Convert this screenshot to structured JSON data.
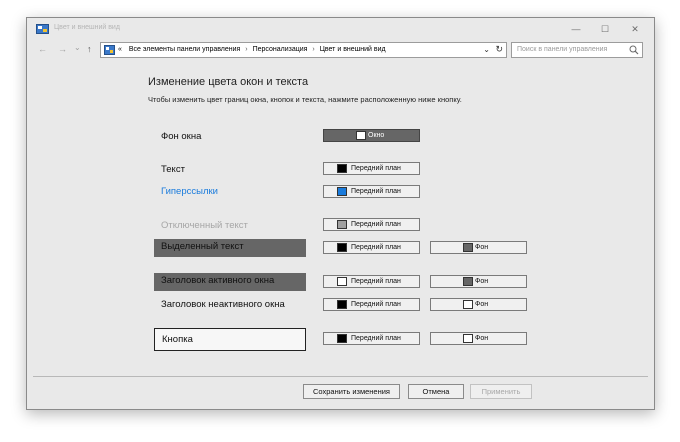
{
  "window": {
    "title": "Цвет и внешний вид",
    "minimize_glyph": "—",
    "maximize_glyph": "☐",
    "close_glyph": "✕"
  },
  "nav": {
    "back_glyph": "←",
    "forward_glyph": "→",
    "recent_glyph": "⌄",
    "up_glyph": "↑"
  },
  "address": {
    "prefix": "«",
    "crumbs": [
      "Все элементы панели управления",
      "Персонализация",
      "Цвет и внешний вид"
    ],
    "separator": "›",
    "chevron": "⌄",
    "refresh": "↻"
  },
  "search": {
    "placeholder": "Поиск в панели управления"
  },
  "content": {
    "heading": "Изменение цвета окон и текста",
    "subtitle": "Чтобы изменить цвет границ окна, кнопок и текста, нажмите расположенную ниже кнопку."
  },
  "rows": {
    "window_bg": {
      "label": "Фон окна",
      "btn": "Окно",
      "swatch": "#ffffff"
    },
    "text": {
      "label": "Текст",
      "btn": "Передний план",
      "swatch": "#000000"
    },
    "hyperlinks": {
      "label": "Гиперссылки",
      "btn": "Передний план",
      "swatch": "#1a7bdc",
      "label_color": "#1a7bdc"
    },
    "disabled_text": {
      "label": "Отключенный текст",
      "btn": "Передний план",
      "swatch": "#a0a0a0",
      "label_color": "#a6a6a6"
    },
    "selected_text": {
      "label": "Выделенный текст",
      "fg_btn": "Передний план",
      "fg_swatch": "#000000",
      "bg_btn": "Фон",
      "bg_swatch": "#666666",
      "box_color": "#666666"
    },
    "active_title": {
      "label": "Заголовок активного окна",
      "fg_btn": "Передний план",
      "fg_swatch": "#ffffff",
      "bg_btn": "Фон",
      "bg_swatch": "#666666",
      "box_color": "#666666"
    },
    "inactive_title": {
      "label": "Заголовок неактивного окна",
      "fg_btn": "Передний план",
      "fg_swatch": "#000000",
      "bg_btn": "Фон",
      "bg_swatch": "#ffffff"
    },
    "button": {
      "label": "Кнопка",
      "fg_btn": "Передний план",
      "fg_swatch": "#000000",
      "bg_btn": "Фон",
      "bg_swatch": "#ffffff"
    }
  },
  "footer": {
    "save": "Сохранить изменения",
    "cancel": "Отмена",
    "apply": "Применить"
  }
}
